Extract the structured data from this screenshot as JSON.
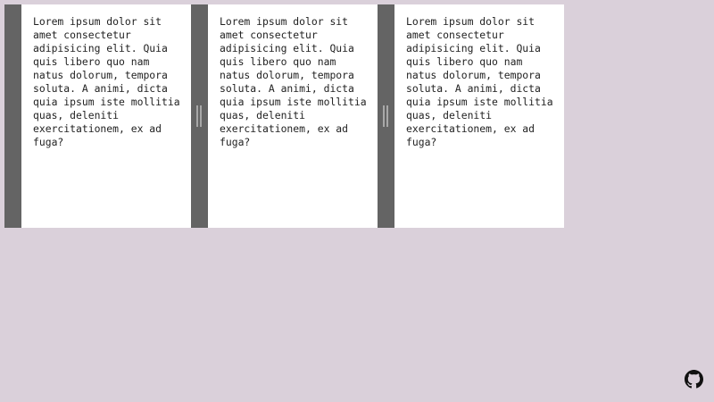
{
  "panels": [
    {
      "has_handle": false,
      "text": "Lorem ipsum dolor sit amet consectetur adipisicing elit. Quia quis libero quo nam natus dolorum, tempora soluta. A animi, dicta quia ipsum iste mollitia quas, deleniti exercitationem, ex ad fuga?"
    },
    {
      "has_handle": true,
      "text": "Lorem ipsum dolor sit amet consectetur adipisicing elit. Quia quis libero quo nam natus dolorum, tempora soluta. A animi, dicta quia ipsum iste mollitia quas, deleniti exercitationem, ex ad fuga?"
    },
    {
      "has_handle": true,
      "text": "Lorem ipsum dolor sit amet consectetur adipisicing elit. Quia quis libero quo nam natus dolorum, tempora soluta. A animi, dicta quia ipsum iste mollitia quas, deleniti exercitationem, ex ad fuga?"
    }
  ],
  "colors": {
    "background": "#dad0da",
    "panel_bar": "#646464",
    "panel_body": "#ffffff",
    "grip": "#a8a8a8",
    "text": "#222222",
    "github_icon": "#111111"
  },
  "corner_link": {
    "icon": "github-icon"
  }
}
